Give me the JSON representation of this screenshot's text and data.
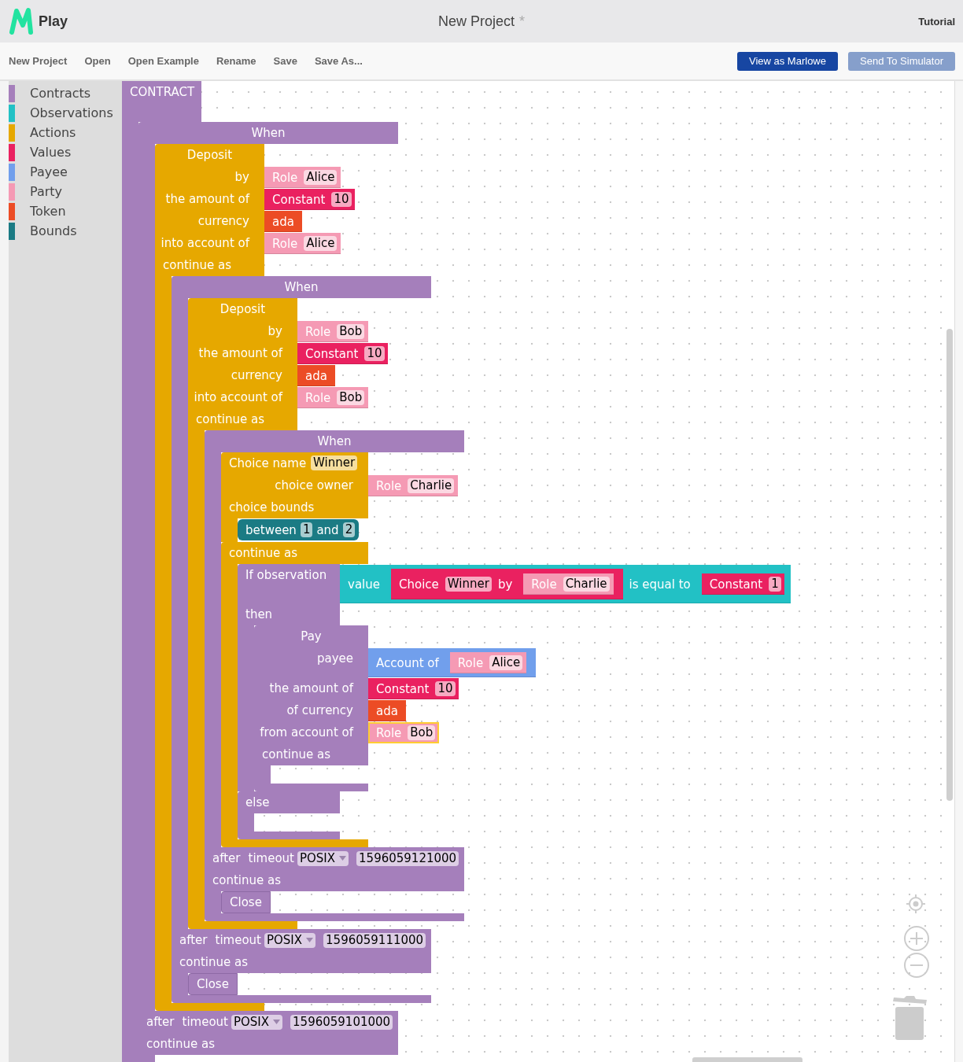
{
  "app_bar": {
    "app_name": "Play",
    "project_title": "New Project",
    "unsaved_mark": "*",
    "tutorial": "Tutorial"
  },
  "menu": {
    "items": [
      "New Project",
      "Open",
      "Open Example",
      "Rename",
      "Save",
      "Save As..."
    ],
    "actions": [
      {
        "label": "View as Marlowe",
        "disabled": false
      },
      {
        "label": "Send To Simulator",
        "disabled": true
      }
    ]
  },
  "toolbox": [
    {
      "label": "Contracts",
      "color": "#a57fbb",
      "selected": false
    },
    {
      "label": "Observations",
      "color": "#22c1c5",
      "selected": false
    },
    {
      "label": "Actions",
      "color": "#e6a800",
      "selected": false
    },
    {
      "label": "Values",
      "color": "#ea2160",
      "selected": false
    },
    {
      "label": "Payee",
      "color": "#719fec",
      "selected": false
    },
    {
      "label": "Party",
      "color": "#f59ab4",
      "selected": false
    },
    {
      "label": "Token",
      "color": "#ec4c25",
      "selected": false
    },
    {
      "label": "Bounds",
      "color": "#1b7b84",
      "selected": false
    }
  ],
  "workspace": {
    "label": "CONTRACT",
    "contract": {
      "kind": "when",
      "label": "When",
      "cases": [
        {
          "kind": "deposit",
          "label": "Deposit",
          "inputs": [
            {
              "label": "by",
              "value": {
                "kind": "role",
                "label": "Role",
                "name": "Alice",
                "selected": false
              }
            },
            {
              "label": "the amount of",
              "value": {
                "kind": "constant",
                "label": "Constant",
                "amount": "10",
                "selected": false
              }
            },
            {
              "label": "currency",
              "value": {
                "kind": "token",
                "label": "ada",
                "selected": false
              }
            },
            {
              "label": "into account of",
              "value": {
                "kind": "role",
                "label": "Role",
                "name": "Alice",
                "selected": false
              }
            }
          ],
          "continue_label": "continue as",
          "continuation": {
            "kind": "when",
            "label": "When",
            "cases": [
              {
                "kind": "deposit",
                "label": "Deposit",
                "inputs": [
                  {
                    "label": "by",
                    "value": {
                      "kind": "role",
                      "label": "Role",
                      "name": "Bob",
                      "selected": false
                    }
                  },
                  {
                    "label": "the amount of",
                    "value": {
                      "kind": "constant",
                      "label": "Constant",
                      "amount": "10",
                      "selected": false
                    }
                  },
                  {
                    "label": "currency",
                    "value": {
                      "kind": "token",
                      "label": "ada",
                      "selected": false
                    }
                  },
                  {
                    "label": "into account of",
                    "value": {
                      "kind": "role",
                      "label": "Role",
                      "name": "Bob",
                      "selected": false
                    }
                  }
                ],
                "continue_label": "continue as",
                "continuation": {
                  "kind": "when",
                  "label": "When",
                  "cases": [
                    {
                      "kind": "choice",
                      "label": "Choice name",
                      "name": "Winner",
                      "inputs": [
                        {
                          "label": "choice owner",
                          "value": {
                            "kind": "role",
                            "label": "Role",
                            "name": "Charlie",
                            "selected": false
                          }
                        }
                      ],
                      "bounds_label": "choice bounds",
                      "bounds": [
                        {
                          "kind": "bound",
                          "label": "between",
                          "min": "1",
                          "and": "and",
                          "max": "2",
                          "selected": false
                        }
                      ],
                      "continue_label": "continue as",
                      "continuation": {
                        "kind": "if",
                        "label": "If observation",
                        "observation": {
                          "kind": "value_eq",
                          "label": "value",
                          "value": {
                            "kind": "choice_value",
                            "label": "Choice",
                            "name": "Winner",
                            "by": "by",
                            "owner": {
                              "kind": "role",
                              "label": "Role",
                              "name": "Charlie",
                              "selected": false
                            },
                            "selected": false
                          },
                          "eq_label": "is equal to",
                          "rhs": {
                            "kind": "constant",
                            "label": "Constant",
                            "amount": "1",
                            "selected": false
                          },
                          "selected": false
                        },
                        "then_label": "then",
                        "then": {
                          "kind": "pay",
                          "label": "Pay",
                          "inputs": [
                            {
                              "label": "payee",
                              "value": {
                                "kind": "account",
                                "label": "Account of",
                                "owner": {
                                  "kind": "role",
                                  "label": "Role",
                                  "name": "Alice",
                                  "selected": false
                                },
                                "selected": false
                              }
                            },
                            {
                              "label": "the amount of",
                              "value": {
                                "kind": "constant",
                                "label": "Constant",
                                "amount": "10",
                                "selected": false
                              }
                            },
                            {
                              "label": "of currency",
                              "value": {
                                "kind": "token",
                                "label": "ada",
                                "selected": false
                              }
                            },
                            {
                              "label": "from account of",
                              "value": {
                                "kind": "role",
                                "label": "Role",
                                "name": "Bob",
                                "selected": true
                              }
                            }
                          ],
                          "continue_label": "continue as"
                        },
                        "else_label": "else"
                      }
                    }
                  ],
                  "timeout": {
                    "after": "after",
                    "label": "timeout",
                    "unit": "POSIX",
                    "value": "1596059121000"
                  },
                  "continue_label": "continue as",
                  "continuation": {
                    "kind": "close",
                    "label": "Close"
                  }
                }
              }
            ],
            "timeout": {
              "after": "after",
              "label": "timeout",
              "unit": "POSIX",
              "value": "1596059111000"
            },
            "continue_label": "continue as",
            "continuation": {
              "kind": "close",
              "label": "Close"
            }
          }
        }
      ],
      "timeout": {
        "after": "after",
        "label": "timeout",
        "unit": "POSIX",
        "value": "1596059101000"
      },
      "continue_label": "continue as"
    }
  }
}
